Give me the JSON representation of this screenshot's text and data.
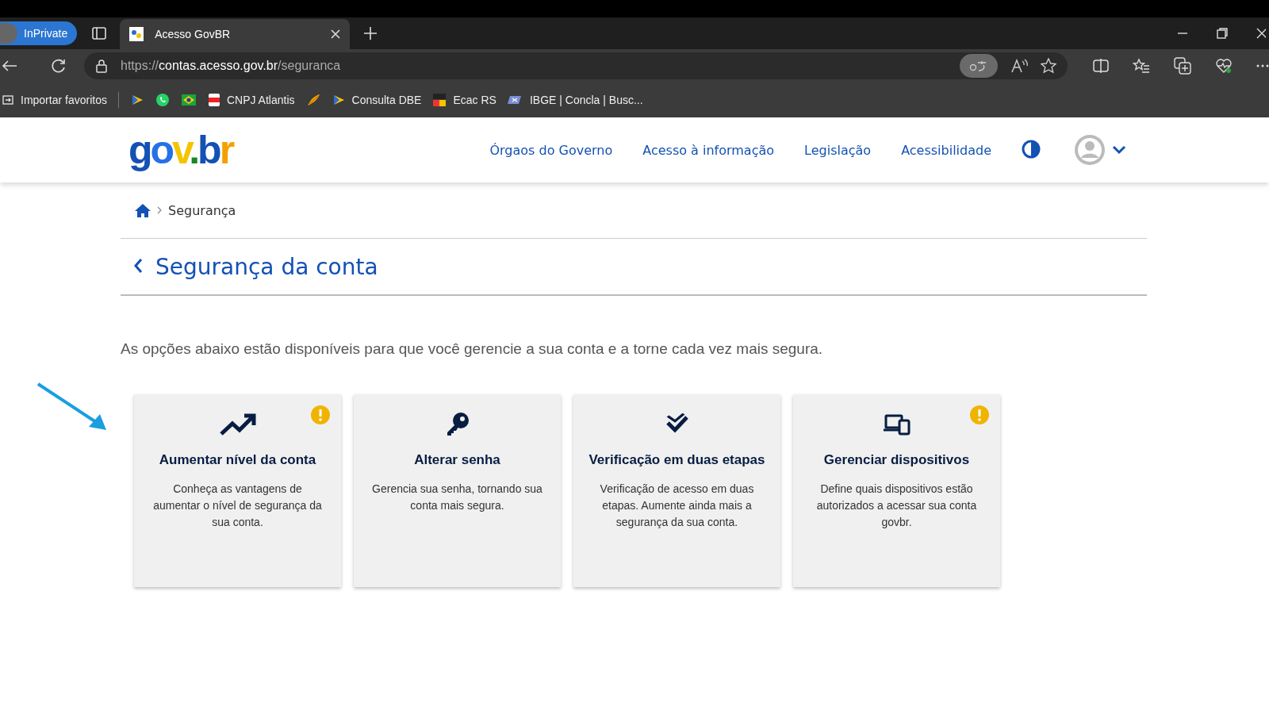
{
  "browser": {
    "private_label": "InPrivate",
    "tab_title": "Acesso GovBR",
    "url_prefix": "https://",
    "url_host": "contas.acesso.gov.br",
    "url_path": "/seguranca",
    "bookmarks": [
      {
        "label": "Importar favoritos",
        "kind": "import"
      },
      {
        "kind": "gov"
      },
      {
        "kind": "whatsapp"
      },
      {
        "kind": "flag"
      },
      {
        "label": "CNPJ Atlantis",
        "kind": "pdf"
      },
      {
        "kind": "feather"
      },
      {
        "label": "Consulta DBE",
        "kind": "gov"
      },
      {
        "label": "Ecac RS",
        "kind": "sefaz"
      },
      {
        "label": "IBGE | Concla | Busc...",
        "kind": "ibge"
      }
    ]
  },
  "header": {
    "logo": "gov.br",
    "nav": [
      "Órgaos do Governo",
      "Acesso à informação",
      "Legislação",
      "Acessibilidade"
    ]
  },
  "breadcrumb": {
    "current": "Segurança"
  },
  "page_title": "Segurança da conta",
  "intro": "As opções abaixo estão disponíveis para que você gerencie a sua conta e a torne cada vez mais segura.",
  "cards": [
    {
      "kind": "chart",
      "title": "Aumentar nível da conta",
      "text": "Conheça as vantagens de aumentar o nível de segurança da sua conta.",
      "alert": true
    },
    {
      "kind": "key",
      "title": "Alterar senha",
      "text": "Gerencia sua senha, tornando sua conta mais segura.",
      "alert": false
    },
    {
      "kind": "check",
      "title": "Verificação em duas etapas",
      "text": "Verificação de acesso em duas etapas. Aumente ainda mais a segurança da sua conta.",
      "alert": false
    },
    {
      "kind": "devices",
      "title": "Gerenciar dispositivos",
      "text": "Define quais dispositivos estão autorizados a acessar sua conta govbr.",
      "alert": true
    }
  ]
}
